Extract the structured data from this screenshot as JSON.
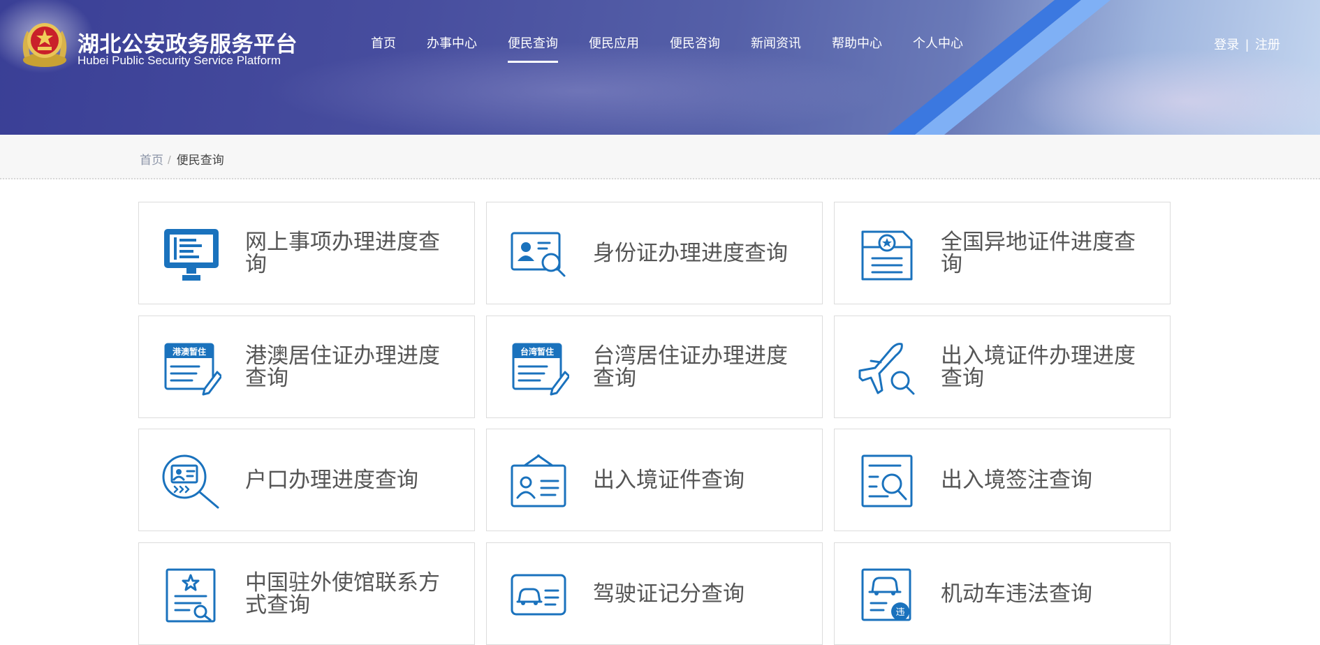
{
  "header": {
    "title": "湖北公安政务服务平台",
    "subtitle": "Hubei Public Security Service Platform",
    "nav": [
      {
        "label": "首页",
        "active": false
      },
      {
        "label": "办事中心",
        "active": false
      },
      {
        "label": "便民查询",
        "active": true
      },
      {
        "label": "便民应用",
        "active": false
      },
      {
        "label": "便民咨询",
        "active": false
      },
      {
        "label": "新闻资讯",
        "active": false
      },
      {
        "label": "帮助中心",
        "active": false
      },
      {
        "label": "个人中心",
        "active": false
      }
    ],
    "login": "登录",
    "auth_separator": "|",
    "register": "注册"
  },
  "breadcrumb": {
    "home": "首页",
    "separator": "/",
    "current": "便民查询"
  },
  "cards": [
    {
      "label": "网上事项办理进度查询",
      "icon": "computer-icon"
    },
    {
      "label": "身份证办理进度查询",
      "icon": "id-card-search-icon"
    },
    {
      "label": "全国异地证件进度查询",
      "icon": "certificate-badge-icon"
    },
    {
      "label": "港澳居住证办理进度查询",
      "icon": "hk-macau-permit-icon",
      "icon_text": "港澳暂住"
    },
    {
      "label": "台湾居住证办理进度查询",
      "icon": "taiwan-permit-icon",
      "icon_text": "台湾暂住"
    },
    {
      "label": "出入境证件办理进度查询",
      "icon": "airplane-search-icon"
    },
    {
      "label": "户口办理进度查询",
      "icon": "household-search-icon"
    },
    {
      "label": "出入境证件查询",
      "icon": "hanging-id-card-icon"
    },
    {
      "label": "出入境签注查询",
      "icon": "document-search-icon"
    },
    {
      "label": "中国驻外使馆联系方式查询",
      "icon": "embassy-document-icon"
    },
    {
      "label": "驾驶证记分查询",
      "icon": "driving-license-icon"
    },
    {
      "label": "机动车违法查询",
      "icon": "vehicle-violation-icon",
      "icon_text": "违"
    }
  ],
  "colors": {
    "header_start": "#3a3f96",
    "icon_blue": "#1a72bd",
    "card_text": "#555555",
    "stripe_blue": "#3b78e0",
    "stripe_light": "#7fb0f5"
  }
}
